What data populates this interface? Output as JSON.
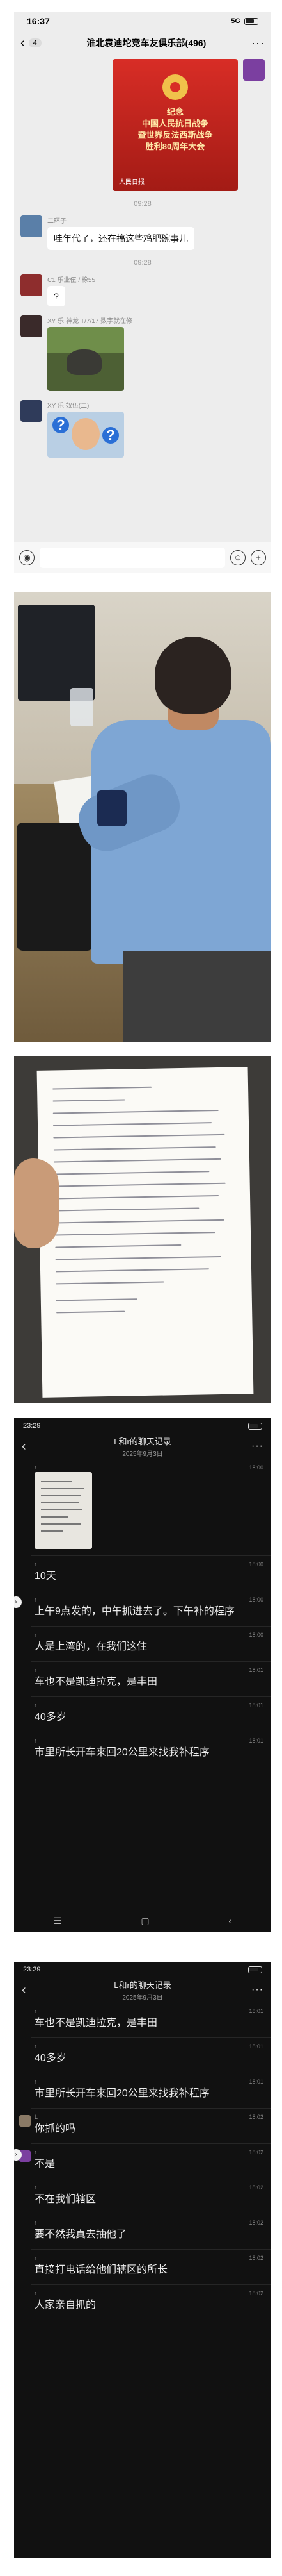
{
  "panel1": {
    "status_time": "16:37",
    "signal": "5G",
    "battery": "60",
    "back_count": "4",
    "title": "淮北袁迪坨竞车友俱乐部(496)",
    "timestamps": [
      "09:00",
      "09:28",
      "09:28"
    ],
    "poster": {
      "lines": [
        "纪念",
        "中国人民抗日战争",
        "暨世界反法西斯战争",
        "胜利80周年大会"
      ],
      "source": "人民日报"
    },
    "messages": [
      {
        "nick": "二环子",
        "text": "哇年代了，还在搞这些鸡肥碗事儿"
      },
      {
        "nick": "C1 乐业伍 / 橡55",
        "text": "?"
      },
      {
        "nick": "XY 乐·神龙 T/7/17  数字就在修"
      },
      {
        "nick": "XY 乐 奴伍(二)"
      }
    ],
    "qmarks": [
      "?",
      "?"
    ],
    "input_icons": {
      "voice": "◉",
      "emoji": "☺",
      "plus": "+"
    }
  },
  "panel4": {
    "status_time": "23:29",
    "title": "L和r的聊天记录",
    "date": "2025年9月3日",
    "sender": "r",
    "rows": [
      {
        "time": "18:00",
        "text": ""
      },
      {
        "time": "18:00",
        "text": "10天"
      },
      {
        "time": "18:00",
        "text": "上午9点发的，中午抓进去了。下午补的程序"
      },
      {
        "time": "18:00",
        "text": "人是上湾的，在我们这住"
      },
      {
        "time": "18:01",
        "text": "车也不是凯迪拉克，是丰田"
      },
      {
        "time": "18:01",
        "text": "40多岁"
      },
      {
        "time": "18:01",
        "text": "市里所长开车来回20公里来找我补程序"
      }
    ],
    "nav": [
      "☰",
      "▢",
      "‹"
    ]
  },
  "panel5": {
    "status_time": "23:29",
    "title": "L和r的聊天记录",
    "date": "2025年9月3日",
    "rows": [
      {
        "sender": "r",
        "time": "18:01",
        "text": "车也不是凯迪拉克，是丰田"
      },
      {
        "sender": "r",
        "time": "18:01",
        "text": "40多岁"
      },
      {
        "sender": "r",
        "time": "18:01",
        "text": "市里所长开车来回20公里来找我补程序"
      },
      {
        "sender": "L",
        "time": "18:02",
        "text": "你抓的吗"
      },
      {
        "sender": "r",
        "time": "18:02",
        "text": "不是"
      },
      {
        "sender": "r",
        "time": "18:02",
        "text": "不在我们辖区"
      },
      {
        "sender": "r",
        "time": "18:02",
        "text": "要不然我真去抽他了"
      },
      {
        "sender": "r",
        "time": "18:02",
        "text": "直接打电话给他们辖区的所长"
      },
      {
        "sender": "r",
        "time": "18:02",
        "text": "人家亲自抓的"
      }
    ]
  }
}
